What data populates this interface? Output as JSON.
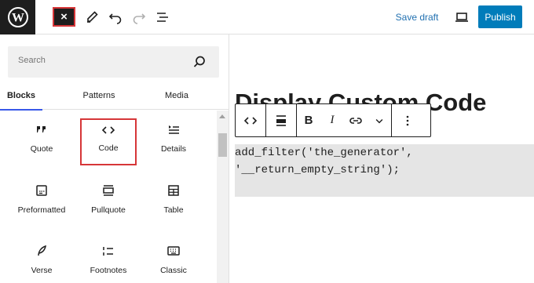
{
  "topbar": {
    "logo_icon": "wordpress-logo-icon",
    "close_label": "×",
    "tools": [
      "edit-pencil-icon",
      "undo-icon",
      "redo-icon",
      "document-overview-icon"
    ],
    "save_draft_label": "Save draft",
    "preview_icon": "preview-desktop-icon",
    "publish_label": "Publish"
  },
  "inserter": {
    "search": {
      "placeholder": "Search"
    },
    "tabs": [
      {
        "label": "Blocks",
        "active": true
      },
      {
        "label": "Patterns",
        "active": false
      },
      {
        "label": "Media",
        "active": false
      }
    ],
    "blocks": [
      {
        "label": "Quote",
        "icon": "quote-icon"
      },
      {
        "label": "Code",
        "icon": "code-icon",
        "selected": true
      },
      {
        "label": "Details",
        "icon": "details-icon"
      },
      {
        "label": "Preformatted",
        "icon": "preformatted-icon"
      },
      {
        "label": "Pullquote",
        "icon": "pullquote-icon"
      },
      {
        "label": "Table",
        "icon": "table-icon"
      },
      {
        "label": "Verse",
        "icon": "verse-icon"
      },
      {
        "label": "Footnotes",
        "icon": "footnotes-icon"
      },
      {
        "label": "Classic",
        "icon": "classic-icon"
      }
    ]
  },
  "editor": {
    "title": "Display Custom Code",
    "toolbar": {
      "block_type_label": "<>",
      "bold_label": "B",
      "italic_label": "I",
      "icons": [
        "code-block-type-icon",
        "align-icon",
        "bold-icon",
        "italic-icon",
        "link-icon",
        "more-rich-text-icon",
        "options-icon"
      ]
    },
    "code_lines": [
      "add_filter('the_generator',",
      "'__return_empty_string');"
    ]
  },
  "colors": {
    "accent": "#3858e9",
    "publish": "#007cba",
    "link": "#2271b1",
    "highlight": "#d63638",
    "dark": "#1e1e1e"
  }
}
